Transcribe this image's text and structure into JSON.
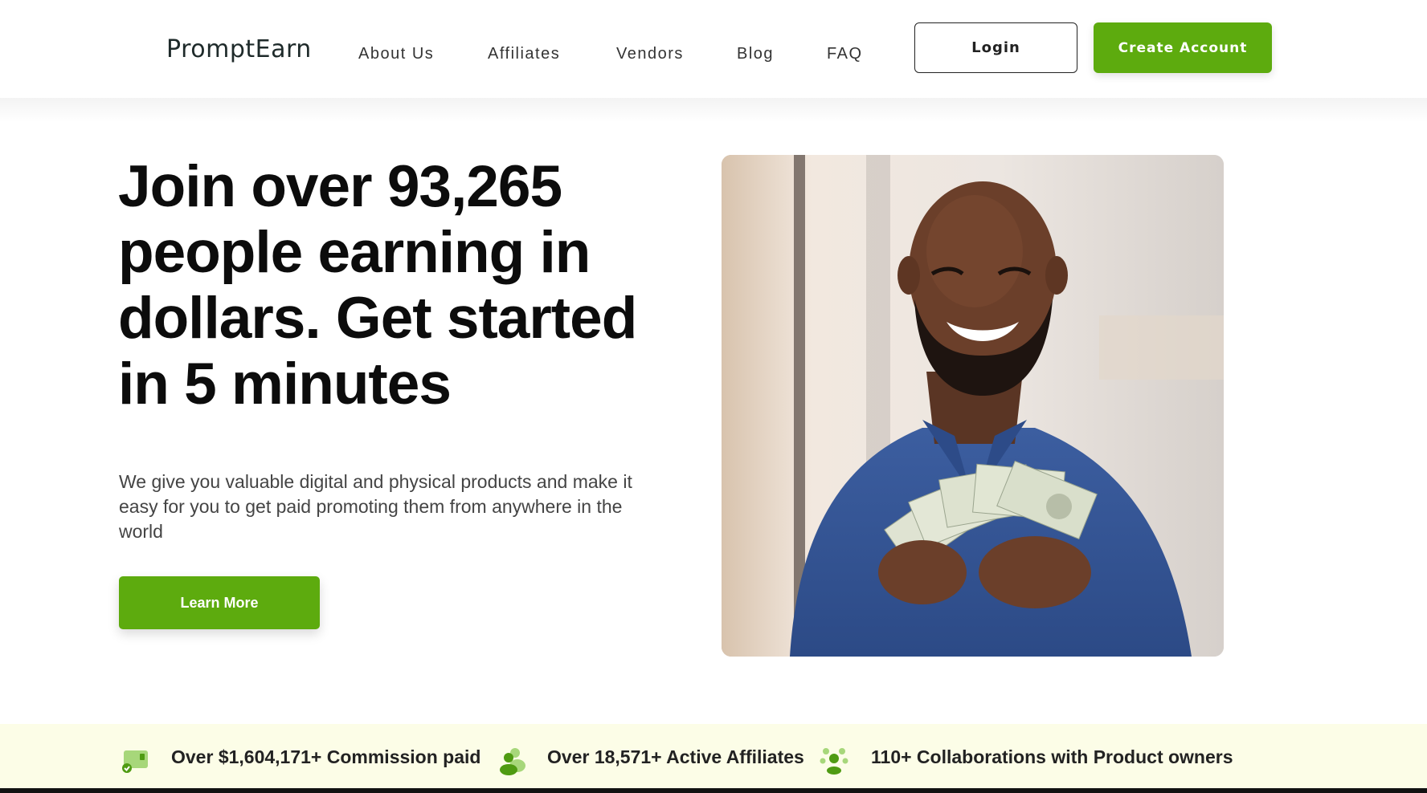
{
  "header": {
    "logo_text": "PromptEarn",
    "nav": [
      {
        "label": "About Us"
      },
      {
        "label": "Affiliates"
      },
      {
        "label": "Vendors"
      },
      {
        "label": "Blog"
      },
      {
        "label": "FAQ"
      }
    ],
    "login_label": "Login",
    "create_account_label": "Create Account"
  },
  "hero": {
    "title": "Join over 93,265 people earning in dollars. Get started in 5 minutes",
    "subtitle": "We give you valuable digital and physical products and make it easy for you to get paid promoting them from anywhere in the world",
    "cta_label": "Learn More",
    "image_icon": "smiling-man-holding-cash-photo"
  },
  "stats": [
    {
      "icon": "commission-money-icon",
      "label": "Over $1,604,171+ Commission paid"
    },
    {
      "icon": "affiliates-group-icon",
      "label": "Over 18,571+ Active Affiliates"
    },
    {
      "icon": "collaboration-network-icon",
      "label": "110+ Collaborations with Product owners"
    }
  ],
  "colors": {
    "brand_green": "#5dab0e",
    "stats_bg": "#fcfde7"
  }
}
